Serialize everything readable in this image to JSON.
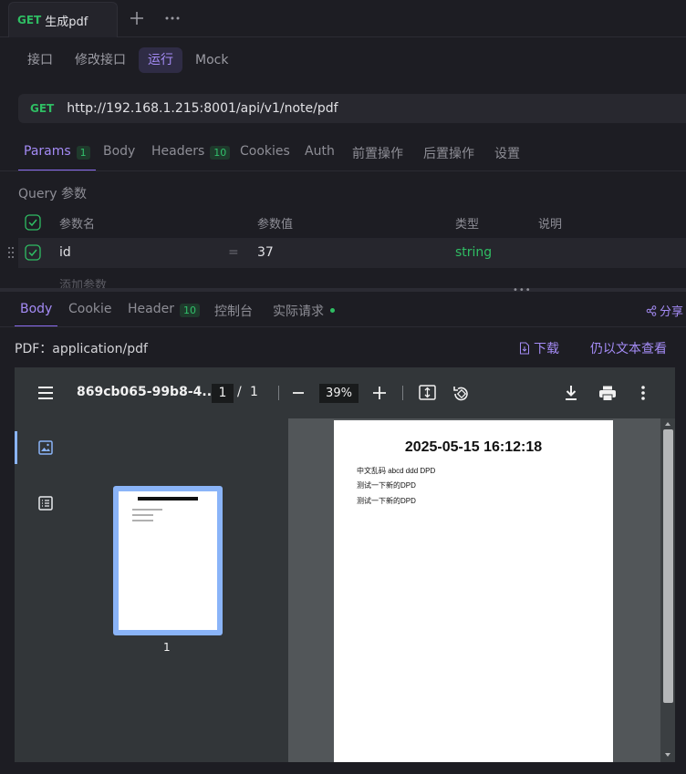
{
  "tab": {
    "method": "GET",
    "title": "生成pdf"
  },
  "subnav": [
    "接口",
    "修改接口",
    "运行",
    "Mock"
  ],
  "url": {
    "method": "GET",
    "value": "http://192.168.1.215:8001/api/v1/note/pdf"
  },
  "request_tabs": [
    {
      "label": "Params",
      "count": "1"
    },
    {
      "label": "Body"
    },
    {
      "label": "Headers",
      "count": "10"
    },
    {
      "label": "Cookies"
    },
    {
      "label": "Auth"
    },
    {
      "label": "前置操作"
    },
    {
      "label": "后置操作"
    },
    {
      "label": "设置"
    }
  ],
  "query": {
    "label": "Query 参数",
    "columns": [
      "参数名",
      "参数值",
      "类型",
      "说明"
    ],
    "row": {
      "name": "id",
      "eq": "=",
      "value": "37",
      "type": "string"
    },
    "add_placeholder": "添加参数"
  },
  "response_tabs": [
    {
      "label": "Body"
    },
    {
      "label": "Cookie"
    },
    {
      "label": "Header",
      "count": "10"
    },
    {
      "label": "控制台"
    },
    {
      "label": "实际请求"
    }
  ],
  "share": "分享",
  "content_type": "PDF：application/pdf",
  "download": "下载",
  "view_as_text": "仍以文本查看",
  "pdf_viewer": {
    "filename": "869cb065-99b8-4...",
    "page": "1",
    "page_sep": "/",
    "total_pages": "1",
    "zoom": "39%",
    "thumbnail_label": "1",
    "page_heading": "2025-05-15 16:12:18",
    "page_lines": [
      "中文乱码 abcd ddd DPD",
      "测试一下新的DPD",
      "测试一下新的DPD"
    ]
  },
  "colors": {
    "accent": "#a48bf5",
    "get": "#2fbd63",
    "string_type": "#2fbd63"
  }
}
